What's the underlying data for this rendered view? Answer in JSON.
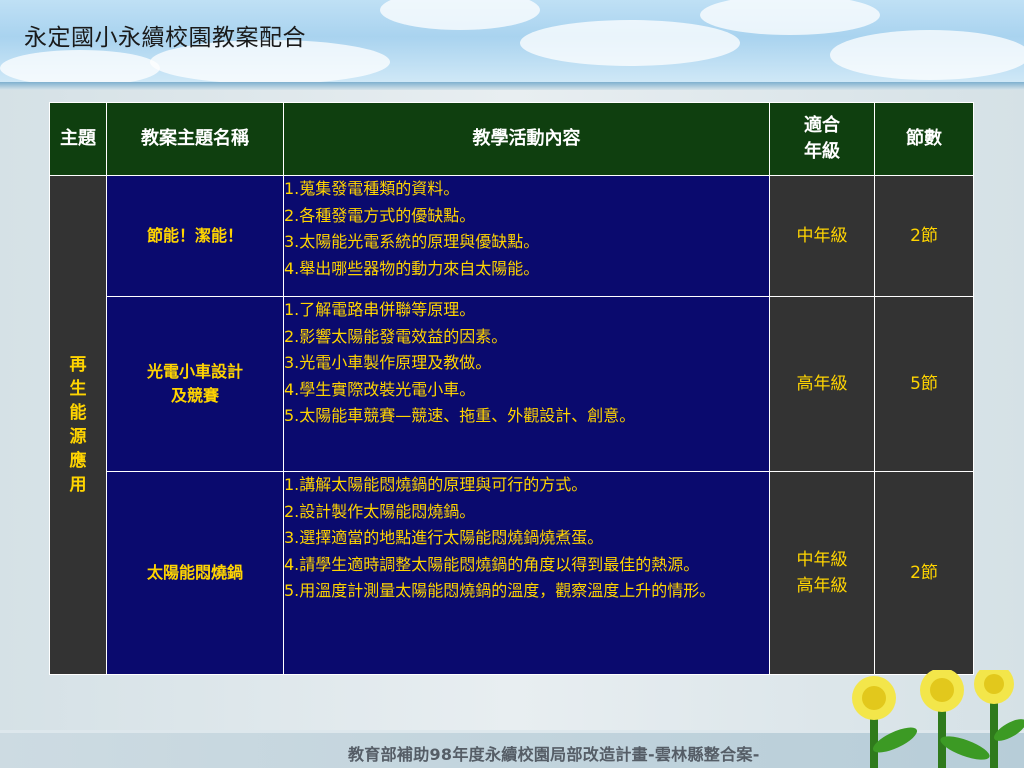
{
  "slide": {
    "title": "永定國小永續校園教案配合",
    "footer": "教育部補助98年度永續校園局部改造計畫-雲林縣整合案-"
  },
  "table": {
    "headers": {
      "theme": "主題",
      "lesson_name": "教案主題名稱",
      "activities": "教學活動內容",
      "grade_line1": "適合",
      "grade_line2": "年級",
      "sessions": "節數"
    },
    "theme_chars": [
      "再",
      "生",
      "能",
      "源",
      "應",
      "用"
    ],
    "rows": [
      {
        "name_lines": [
          "節能！潔能！"
        ],
        "activities": [
          "1.蒐集發電種類的資料。",
          "2.各種發電方式的優缺點。",
          "3.太陽能光電系統的原理與優缺點。",
          "4.舉出哪些器物的動力來自太陽能。"
        ],
        "grade_lines": [
          "中年級"
        ],
        "sessions": "2節"
      },
      {
        "name_lines": [
          "光電小車設計",
          "及競賽"
        ],
        "activities": [
          "1.了解電路串併聯等原理。",
          "2.影響太陽能發電效益的因素。",
          "3.光電小車製作原理及教做。",
          "4.學生實際改裝光電小車。",
          "5.太陽能車競賽—競速、拖重、外觀設計、創意。"
        ],
        "grade_lines": [
          "高年級"
        ],
        "sessions": "5節"
      },
      {
        "name_lines": [
          "太陽能悶燒鍋"
        ],
        "activities": [
          "1.講解太陽能悶燒鍋的原理與可行的方式。",
          "2.設計製作太陽能悶燒鍋。",
          "3.選擇適當的地點進行太陽能悶燒鍋燒煮蛋。",
          "4.請學生適時調整太陽能悶燒鍋的角度以得到最佳的熱源。",
          "5.用溫度計測量太陽能悶燒鍋的溫度，觀察溫度上升的情形。"
        ],
        "grade_lines": [
          "中年級",
          "高年級"
        ],
        "sessions": "2節"
      }
    ]
  },
  "colors": {
    "header_bg": "#0f3f0f",
    "content_bg": "#0a0a6e",
    "side_bg": "#333333",
    "text_yellow": "#ffd400"
  }
}
